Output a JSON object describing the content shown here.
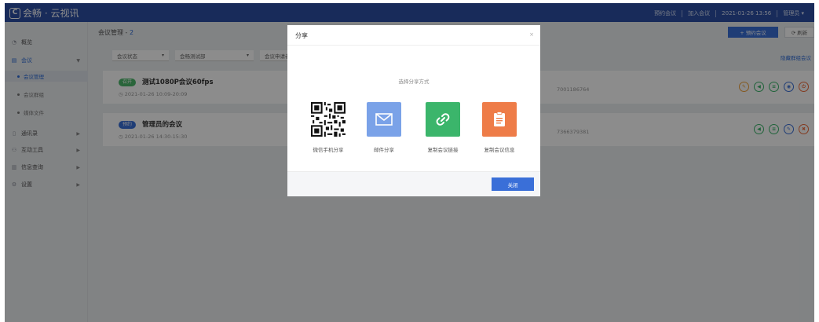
{
  "app": {
    "logo_mark": "C",
    "title": "会畅 · 云视讯"
  },
  "topnav": {
    "book": "预约会议",
    "join": "加入会议",
    "datetime": "2021-01-26 13:56",
    "user": "管理员 ▾"
  },
  "sidebar": {
    "items": [
      {
        "label": "概览",
        "icon": "gauge-icon"
      },
      {
        "label": "会议",
        "icon": "meeting-icon"
      },
      {
        "label": "通讯录",
        "icon": "contacts-icon"
      },
      {
        "label": "互动工具",
        "icon": "tools-icon"
      },
      {
        "label": "信息查询",
        "icon": "chart-icon"
      },
      {
        "label": "设置",
        "icon": "gear-icon"
      }
    ],
    "subitems": [
      {
        "label": "会议管理"
      },
      {
        "label": "会议群组"
      },
      {
        "label": "媒体文件"
      }
    ]
  },
  "main": {
    "title": "会议管理 - ",
    "count": "2",
    "book_button": "+ 预约会议",
    "refresh_button": "⟳ 刷新",
    "filters": [
      "会议状态",
      "会畅测试部",
      "会议申请者"
    ],
    "hidden_group": "隐藏群组会议"
  },
  "meetings": [
    {
      "status": "召开",
      "title": "测试1080P会议60fps",
      "time": "◷ 2021-01-26 10:09-20:09",
      "id": "7001186764"
    },
    {
      "status": "预约",
      "title": "管理员的会议",
      "time": "◷ 2021-01-26 14:30-15:30",
      "id": "7366379381"
    }
  ],
  "colors": {
    "header": "#2c4fa5",
    "primary": "#3a6fd8",
    "green": "#4cb86a",
    "orange": "#ee7c48"
  },
  "modal": {
    "title": "分享",
    "close_x": "×",
    "subtitle": "选择分享方式",
    "options": [
      {
        "label": "微信手机分享",
        "icon": "qr-code-icon"
      },
      {
        "label": "邮件分享",
        "icon": "mail-icon"
      },
      {
        "label": "复制会议链接",
        "icon": "link-icon"
      },
      {
        "label": "复制会议信息",
        "icon": "document-icon"
      }
    ],
    "close_button": "关闭"
  }
}
